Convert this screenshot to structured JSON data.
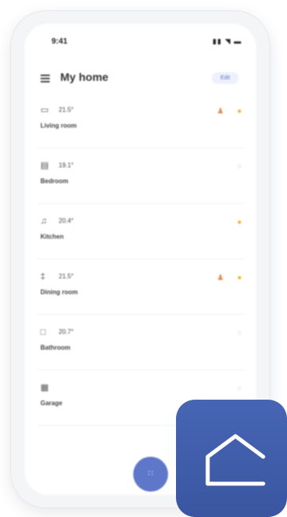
{
  "status": {
    "time": "9:41",
    "icons": "▮▮ ◥ ▬"
  },
  "header": {
    "title": "My home",
    "edit_label": "Edit"
  },
  "rooms": [
    {
      "name": "Living room",
      "temp": "21.5°",
      "icon": "tv-icon",
      "devices": [
        "person-sensor-active",
        "bulb-on"
      ]
    },
    {
      "name": "Bedroom",
      "temp": "19.1°",
      "icon": "bed-icon",
      "devices": [
        "device-off"
      ]
    },
    {
      "name": "Kitchen",
      "temp": "20.4°",
      "icon": "cooking-pot-icon",
      "devices": [
        "bulb-on"
      ]
    },
    {
      "name": "Dining room",
      "temp": "21.5°",
      "icon": "cutlery-icon",
      "devices": [
        "person-sensor-active",
        "bulb-on"
      ]
    },
    {
      "name": "Bathroom",
      "temp": "20.7°",
      "icon": "bathtub-icon",
      "devices": [
        "bulb-off"
      ]
    },
    {
      "name": "Garage",
      "temp": "",
      "icon": "garage-icon",
      "devices": [
        "device-off"
      ]
    }
  ],
  "fab": {
    "icon": "grid-icon"
  },
  "app_icon": {
    "icon": "house-outline-icon",
    "color": "#4563b1"
  },
  "colors": {
    "accent": "#5f77c9",
    "bulb_on": "#f4b53a",
    "person_active": "#e38a48",
    "device_off": "#cfcfcf"
  }
}
